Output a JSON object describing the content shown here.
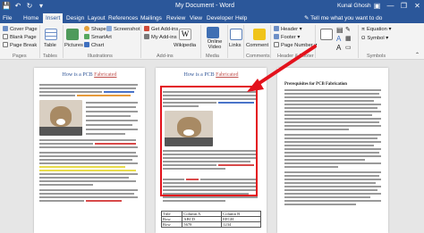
{
  "titlebar": {
    "qat": {
      "save_icon": "💾",
      "undo_icon": "↶",
      "redo_icon": "↻",
      "customize_icon": "▾"
    },
    "title": "My Document - Word",
    "user": "Kunal Ghosh",
    "controls": {
      "ribbon_options_icon": "▣",
      "minimize": "—",
      "maximize": "❐",
      "close": "✕"
    }
  },
  "tabs": [
    "File",
    "Home",
    "Insert",
    "Design",
    "Layout",
    "References",
    "Mailings",
    "Review",
    "View",
    "Developer",
    "Help"
  ],
  "tell_me": "Tell me what you want to do",
  "ribbon": {
    "pages": {
      "cover_page": "Cover Page",
      "blank_page": "Blank Page",
      "page_break": "Page Break",
      "group": "Pages"
    },
    "tables": {
      "label": "Table",
      "group": "Tables"
    },
    "illustrations": {
      "pictures": "Pictures",
      "shapes": "Shapes",
      "smartart": "SmartArt",
      "chart": "Chart",
      "screenshot": "Screenshot",
      "group": "Illustrations"
    },
    "addins": {
      "get_addins": "Get Add-ins",
      "my_addins": "My Add-ins",
      "wikipedia": "Wikipedia",
      "group": "Add-ins"
    },
    "media": {
      "online_video": "Online Video",
      "group": "Media"
    },
    "links": {
      "label": "Links"
    },
    "comments": {
      "comment": "Comment",
      "group": "Comments"
    },
    "header_footer": {
      "header": "Header",
      "footer": "Footer",
      "page_number": "Page Number",
      "group": "Header & Footer"
    },
    "symbols": {
      "equation": "Equation",
      "symbol": "Symbol",
      "group": "Symbols"
    }
  },
  "document": {
    "page_title_prefix": "How is a PCB",
    "page_title_highlight": "Fabricated",
    "page3_heading": "Prerequisites for PCB Fabrication",
    "table": {
      "header": [
        "Title",
        "Column A",
        "Column B"
      ],
      "rows": [
        [
          "Row",
          "ABCD",
          "EFGH"
        ],
        [
          "Row",
          "5678",
          "1234"
        ]
      ]
    }
  }
}
